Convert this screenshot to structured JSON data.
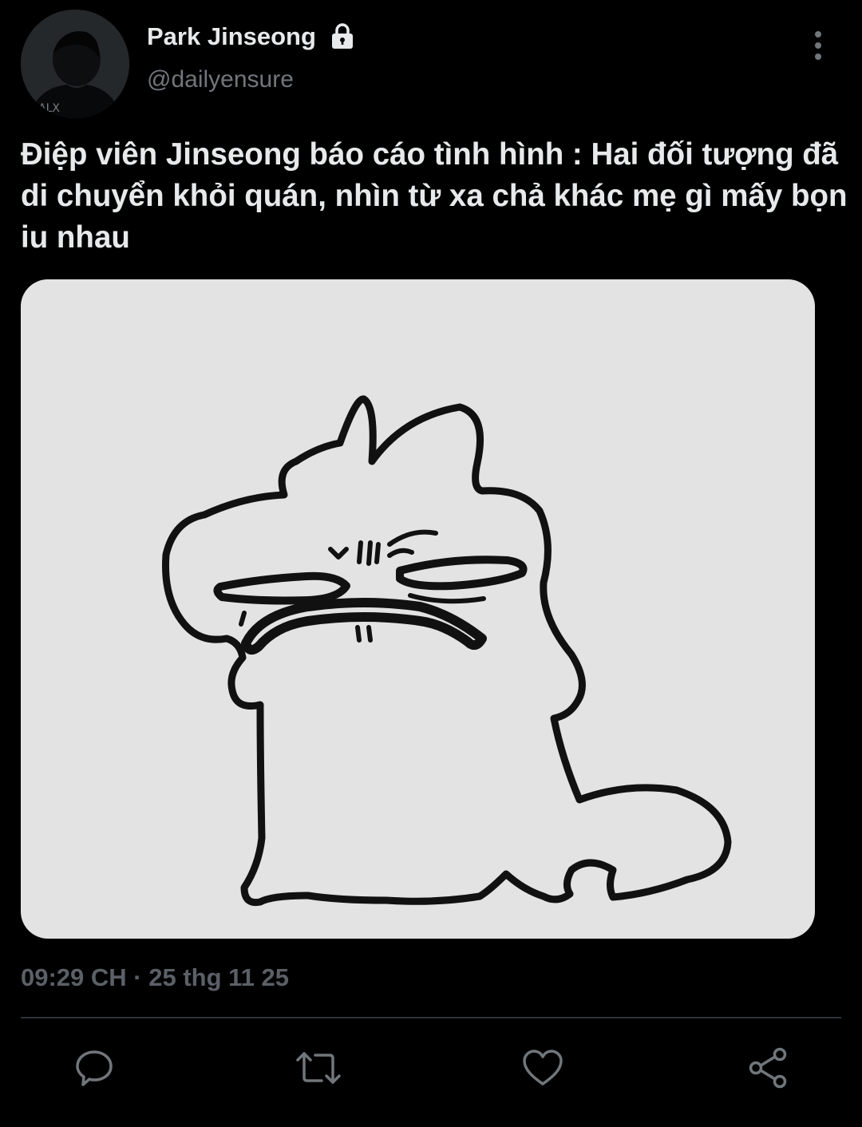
{
  "tweet": {
    "author": {
      "display_name": "Park Jinseong",
      "handle": "@dailyensure",
      "protected_icon": "lock-icon",
      "avatar_icon": "profile-photo"
    },
    "text": "Điệp viên Jinseong báo cáo tình hình : Hai đối tượng đã di chuyển khỏi quán, nhìn từ xa chả khác mẹ gì mấy bọn iu nhau",
    "media": {
      "description_icon": "cartoon-grumpy-creature-image"
    },
    "timestamp": "09:29 CH · 25 thg 11 25",
    "more_icon": "vertical-ellipsis-icon"
  },
  "actions": {
    "reply_icon": "reply-icon",
    "retweet_icon": "retweet-icon",
    "like_icon": "heart-icon",
    "share_icon": "share-icon"
  },
  "colors": {
    "background": "#000000",
    "text_primary": "#e7e9ea",
    "text_secondary": "#71767b",
    "timestamp": "#5b6067",
    "divider": "#2f3336",
    "icon": "#71767b",
    "media_background": "#e3e3e3"
  }
}
